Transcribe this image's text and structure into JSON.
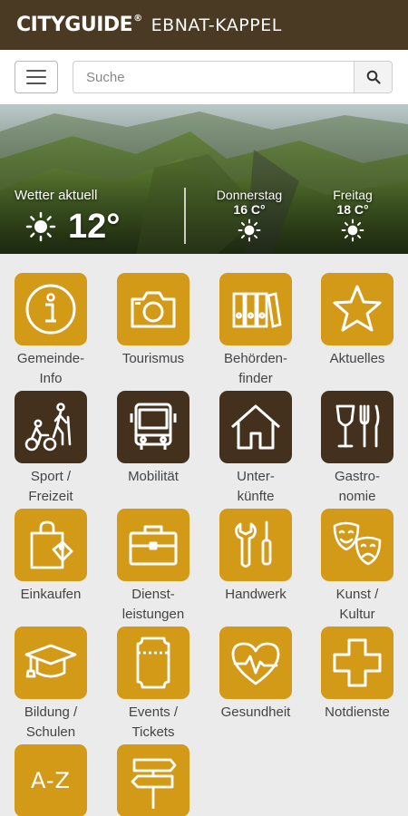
{
  "header": {
    "logo": "CITYGUIDE",
    "logo_mark": "®",
    "city": "EBNAT-KAPPEL"
  },
  "search": {
    "placeholder": "Suche"
  },
  "weather": {
    "label": "Wetter aktuell",
    "current_temp": "12°",
    "current_icon": "sun-icon",
    "forecast": [
      {
        "day": "Donnerstag",
        "temp": "16 C°",
        "icon": "sun-icon"
      },
      {
        "day": "Freitag",
        "temp": "18 C°",
        "icon": "sun-icon"
      }
    ]
  },
  "tiles": [
    {
      "label_1": "Gemeinde-",
      "label_2": "Info",
      "icon": "info-icon",
      "style": "gold"
    },
    {
      "label_1": "Tourismus",
      "label_2": "",
      "icon": "camera-icon",
      "style": "gold"
    },
    {
      "label_1": "Behörden-",
      "label_2": "finder",
      "icon": "binders-icon",
      "style": "gold"
    },
    {
      "label_1": "Aktuelles",
      "label_2": "",
      "icon": "star-icon",
      "style": "gold"
    },
    {
      "label_1": "Sport /",
      "label_2": "Freizeit",
      "icon": "hiker-cyclist-icon",
      "style": "brown"
    },
    {
      "label_1": "Mobilität",
      "label_2": "",
      "icon": "bus-icon",
      "style": "brown"
    },
    {
      "label_1": "Unter-",
      "label_2": "künfte",
      "icon": "house-icon",
      "style": "brown"
    },
    {
      "label_1": "Gastro-",
      "label_2": "nomie",
      "icon": "wine-cutlery-icon",
      "style": "brown"
    },
    {
      "label_1": "Einkaufen",
      "label_2": "",
      "icon": "shopping-bag-icon",
      "style": "gold"
    },
    {
      "label_1": "Dienst-",
      "label_2": "leistungen",
      "icon": "briefcase-icon",
      "style": "gold"
    },
    {
      "label_1": "Handwerk",
      "label_2": "",
      "icon": "tools-icon",
      "style": "gold"
    },
    {
      "label_1": "Kunst /",
      "label_2": "Kultur",
      "icon": "theater-masks-icon",
      "style": "gold"
    },
    {
      "label_1": "Bildung /",
      "label_2": "Schulen",
      "icon": "graduation-cap-icon",
      "style": "gold"
    },
    {
      "label_1": "Events /",
      "label_2": "Tickets",
      "icon": "ticket-icon",
      "style": "gold"
    },
    {
      "label_1": "Gesundheit",
      "label_2": "",
      "icon": "heart-pulse-icon",
      "style": "gold"
    },
    {
      "label_1": "Notdienste",
      "label_2": "",
      "icon": "cross-icon",
      "style": "gold"
    },
    {
      "label_1": "",
      "label_2": "",
      "icon": "a-z-icon",
      "style": "gold",
      "icon_text": "A-Z"
    },
    {
      "label_1": "",
      "label_2": "",
      "icon": "signpost-icon",
      "style": "gold"
    }
  ],
  "colors": {
    "header_bg": "#4a3a24",
    "tile_gold": "#d39a18",
    "tile_brown": "#43311d",
    "page_bg": "#ebebeb"
  }
}
